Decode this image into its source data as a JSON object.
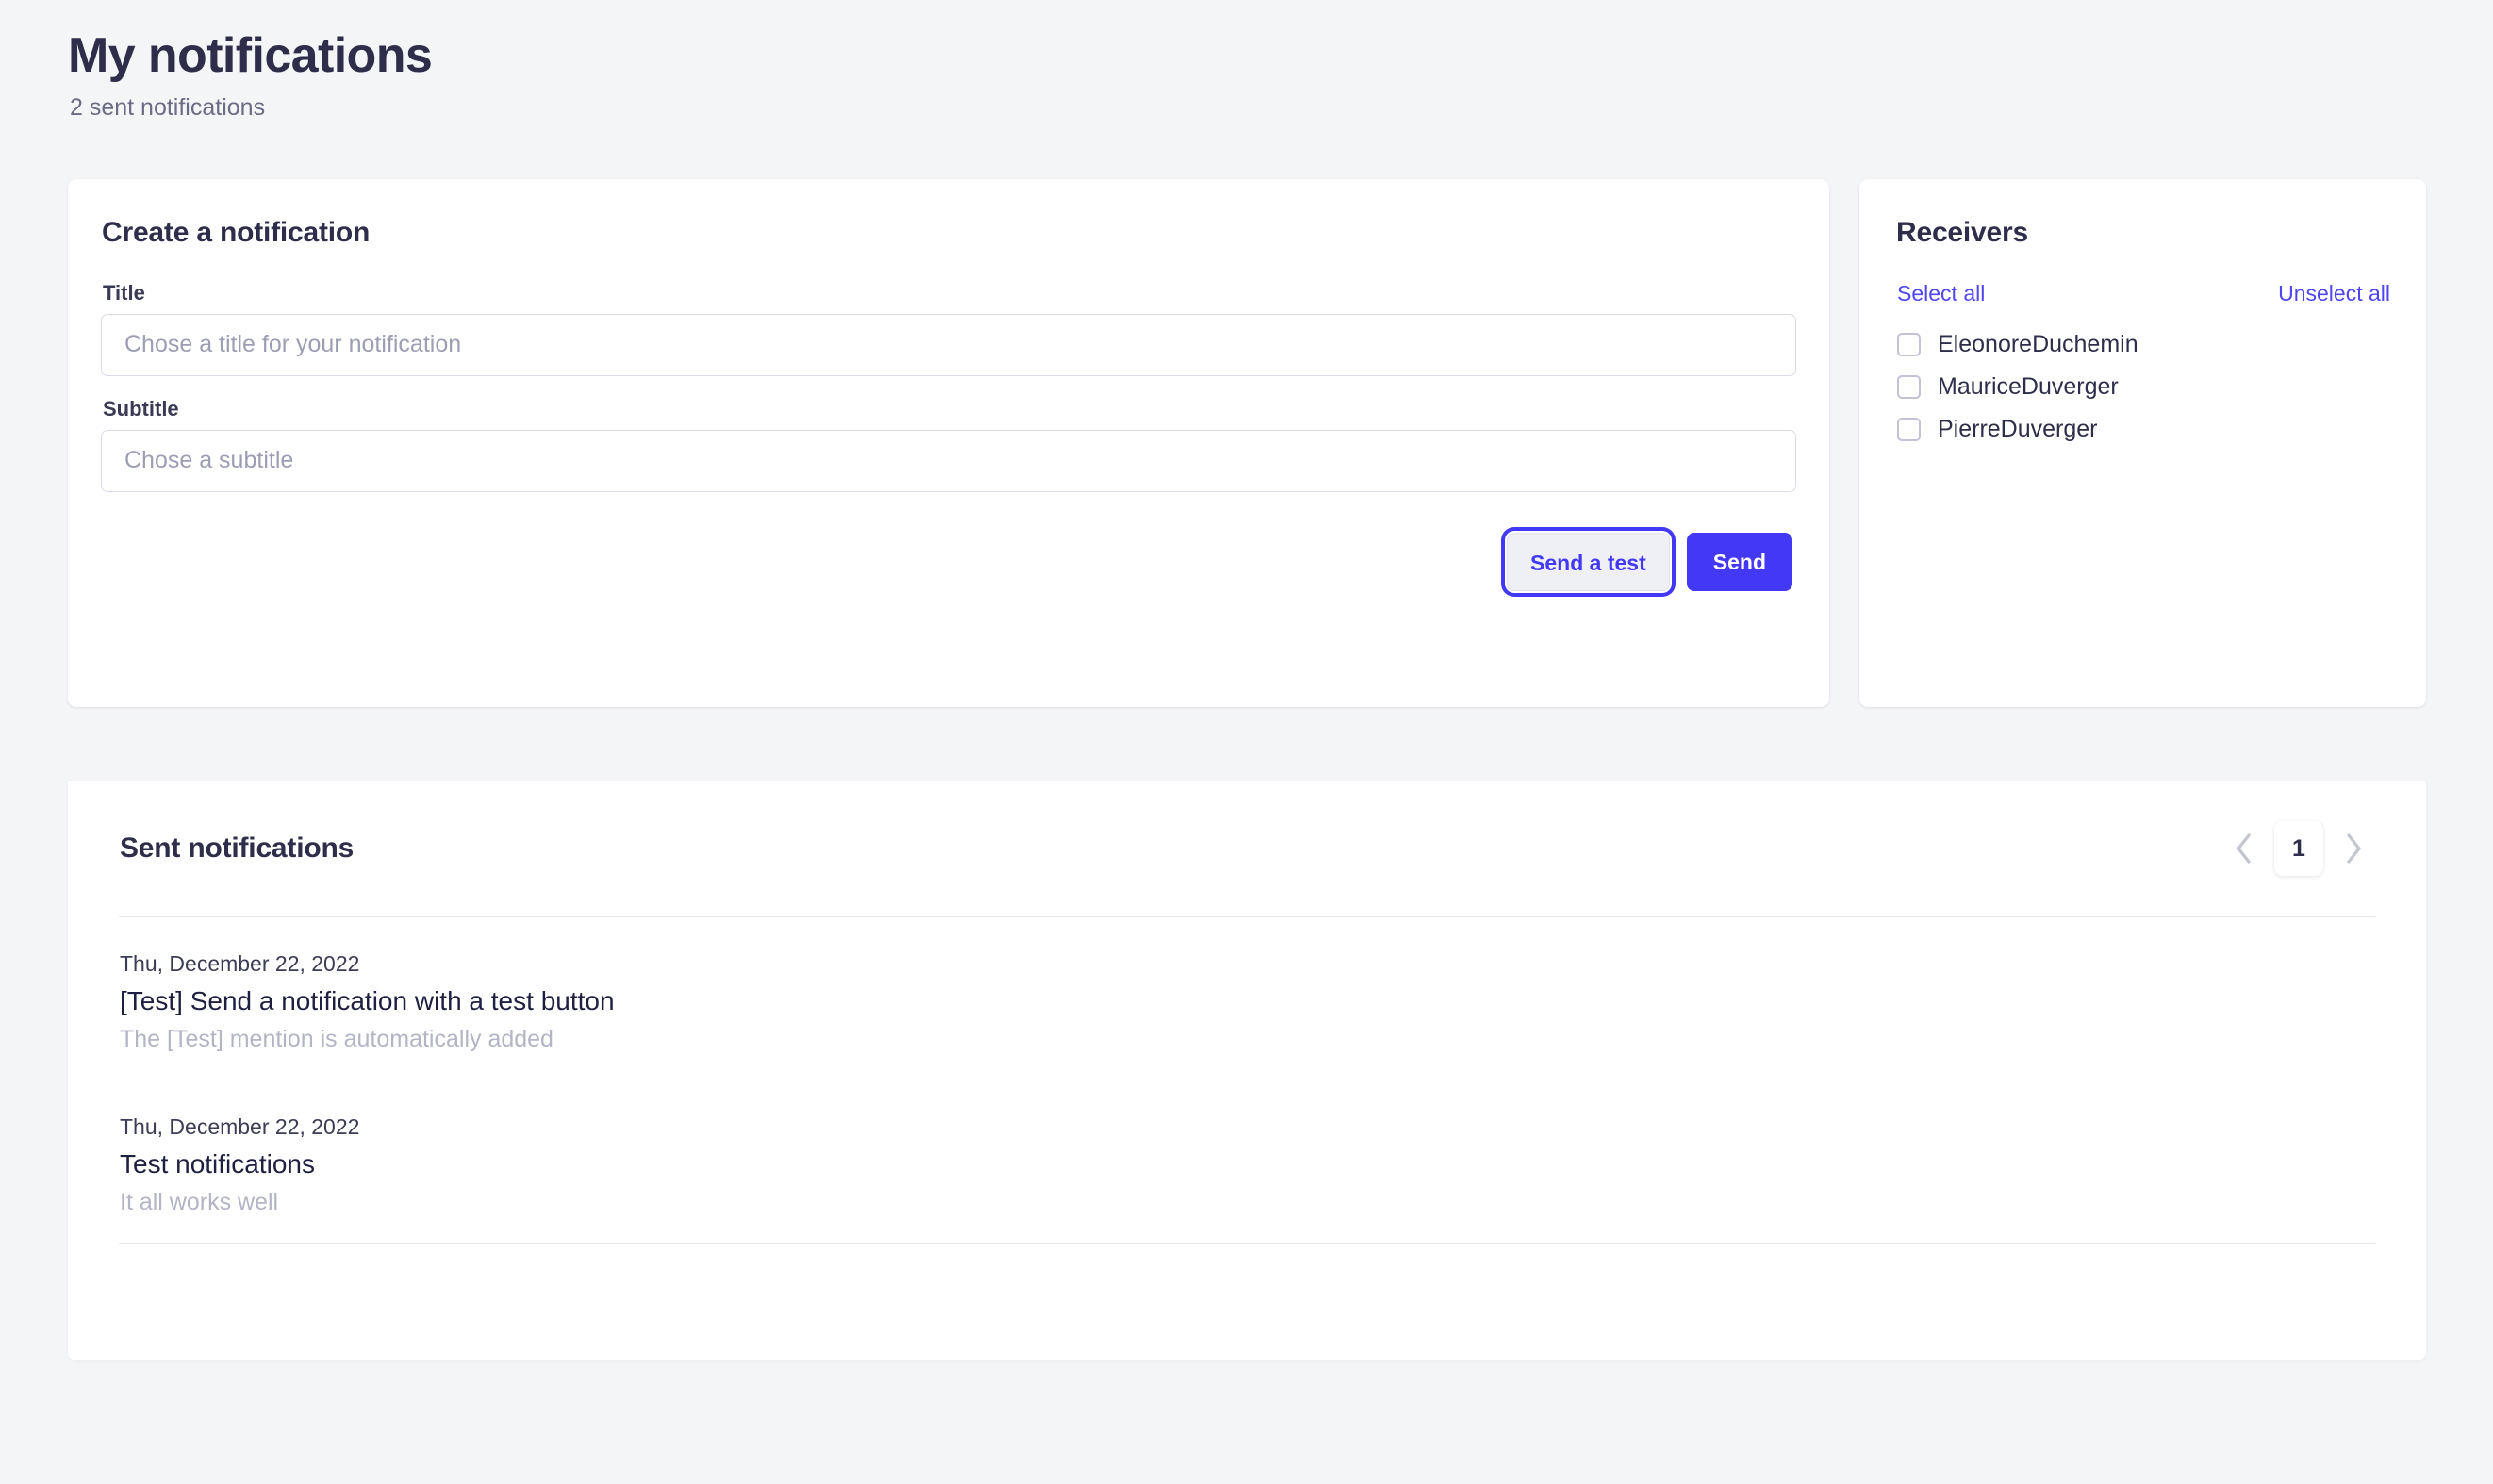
{
  "header": {
    "title": "My notifications",
    "subtitle": "2 sent notifications"
  },
  "create_card": {
    "title": "Create a notification",
    "fields": [
      {
        "label": "Title",
        "value": "",
        "placeholder": "Chose a title for your notification"
      },
      {
        "label": "Subtitle",
        "value": "",
        "placeholder": "Chose a subtitle"
      }
    ],
    "buttons": {
      "test_label": "Send a test",
      "send_label": "Send"
    }
  },
  "receivers_card": {
    "title": "Receivers",
    "select_all_label": "Select all",
    "unselect_all_label": "Unselect all",
    "items": [
      {
        "name": "EleonoreDuchemin",
        "checked": false
      },
      {
        "name": "MauriceDuverger",
        "checked": false
      },
      {
        "name": "PierreDuverger",
        "checked": false
      }
    ]
  },
  "sent_card": {
    "title": "Sent notifications",
    "pagination": {
      "prev_icon": "chevron-left-icon",
      "next_icon": "chevron-right-icon",
      "current_page": "1"
    },
    "items": [
      {
        "date": "Thu, December 22, 2022",
        "title": "[Test] Send a notification with a test button",
        "subtitle": "The [Test] mention is automatically added"
      },
      {
        "date": "Thu, December 22, 2022",
        "title": "Test notifications",
        "subtitle": "It all works well"
      }
    ]
  },
  "colors": {
    "accent": "#4338f5",
    "link": "#4f46f0",
    "page_background": "#f4f5f7",
    "text_primary": "#2e2e4a",
    "text_muted": "#b3b4c4"
  }
}
